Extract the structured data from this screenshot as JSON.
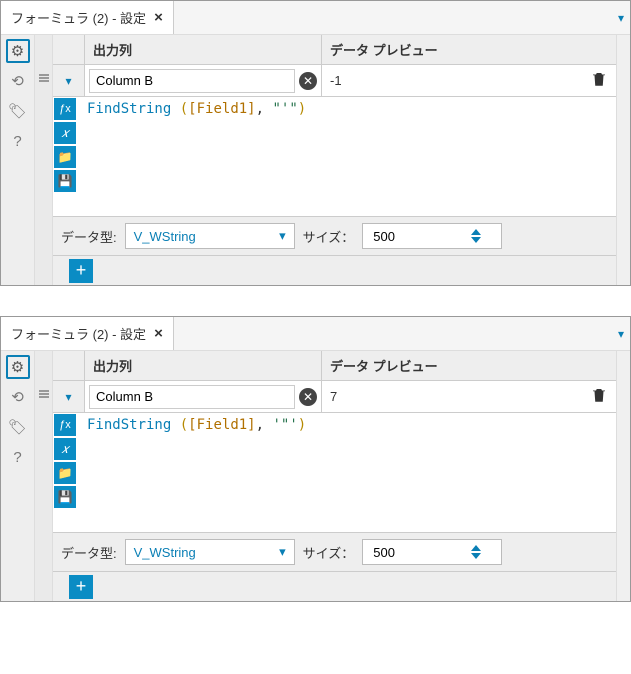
{
  "panels": [
    {
      "tab_title": "フォーミュラ (2) - 設定",
      "header_output": "出力列",
      "header_preview": "データ プレビュー",
      "column_name": "Column B",
      "preview_value": "-1",
      "expr_fn": "FindString",
      "expr_field": "[Field1]",
      "expr_string": "\"'\"",
      "datatype_label": "データ型:",
      "datatype_value": "V_WString",
      "size_label": "サイズ：",
      "size_value": "500"
    },
    {
      "tab_title": "フォーミュラ (2) - 設定",
      "header_output": "出力列",
      "header_preview": "データ プレビュー",
      "column_name": "Column B",
      "preview_value": "7",
      "expr_fn": "FindString",
      "expr_field": "[Field1]",
      "expr_string": "'\"'",
      "datatype_label": "データ型:",
      "datatype_value": "V_WString",
      "size_label": "サイズ：",
      "size_value": "500"
    }
  ]
}
